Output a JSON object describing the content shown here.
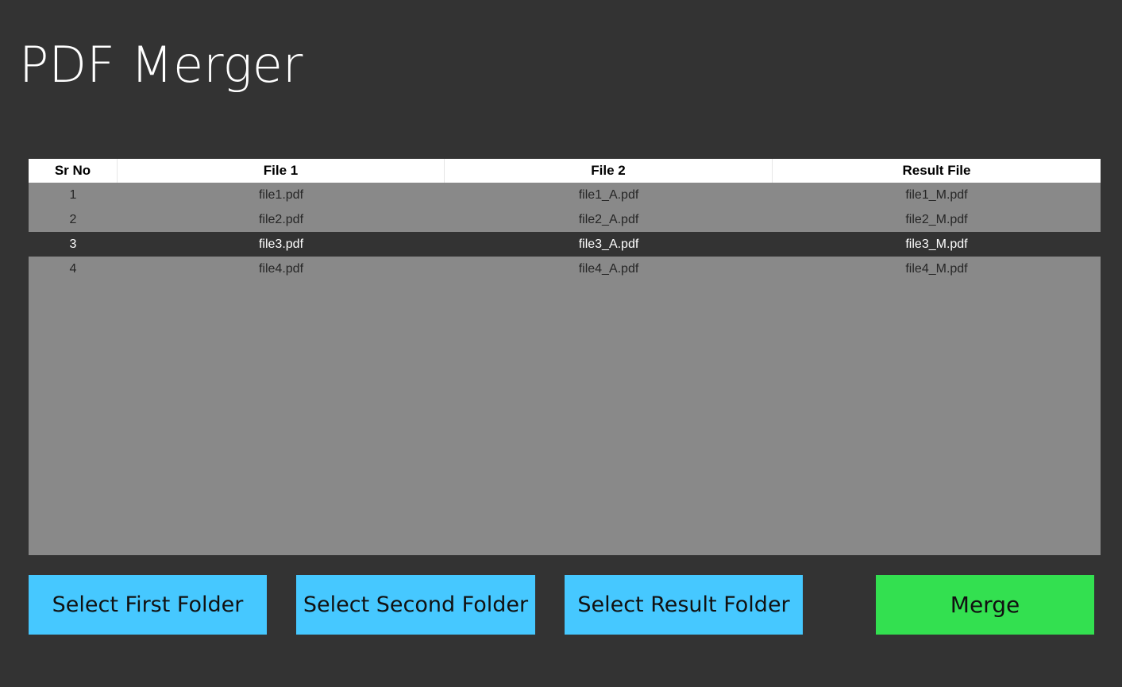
{
  "app": {
    "title": "PDF Merger"
  },
  "table": {
    "columns": [
      "Sr No",
      "File 1",
      "File 2",
      "Result File"
    ],
    "rows": [
      {
        "sr": "1",
        "file1": "file1.pdf",
        "file2": "file1_A.pdf",
        "result": "file1_M.pdf"
      },
      {
        "sr": "2",
        "file1": "file2.pdf",
        "file2": "file2_A.pdf",
        "result": "file2_M.pdf"
      },
      {
        "sr": "3",
        "file1": "file3.pdf",
        "file2": "file3_A.pdf",
        "result": "file3_M.pdf"
      },
      {
        "sr": "4",
        "file1": "file4.pdf",
        "file2": "file4_A.pdf",
        "result": "file4_M.pdf"
      }
    ],
    "selected_row": 2
  },
  "buttons": {
    "select_first": "Select First Folder",
    "select_second": "Select Second Folder",
    "select_result": "Select Result Folder",
    "merge": "Merge"
  },
  "colors": {
    "background": "#333333",
    "table_body": "#898989",
    "header_bg": "#ffffff",
    "selected_row": "#333333",
    "folder_button": "#46c8ff",
    "merge_button": "#33e050"
  }
}
